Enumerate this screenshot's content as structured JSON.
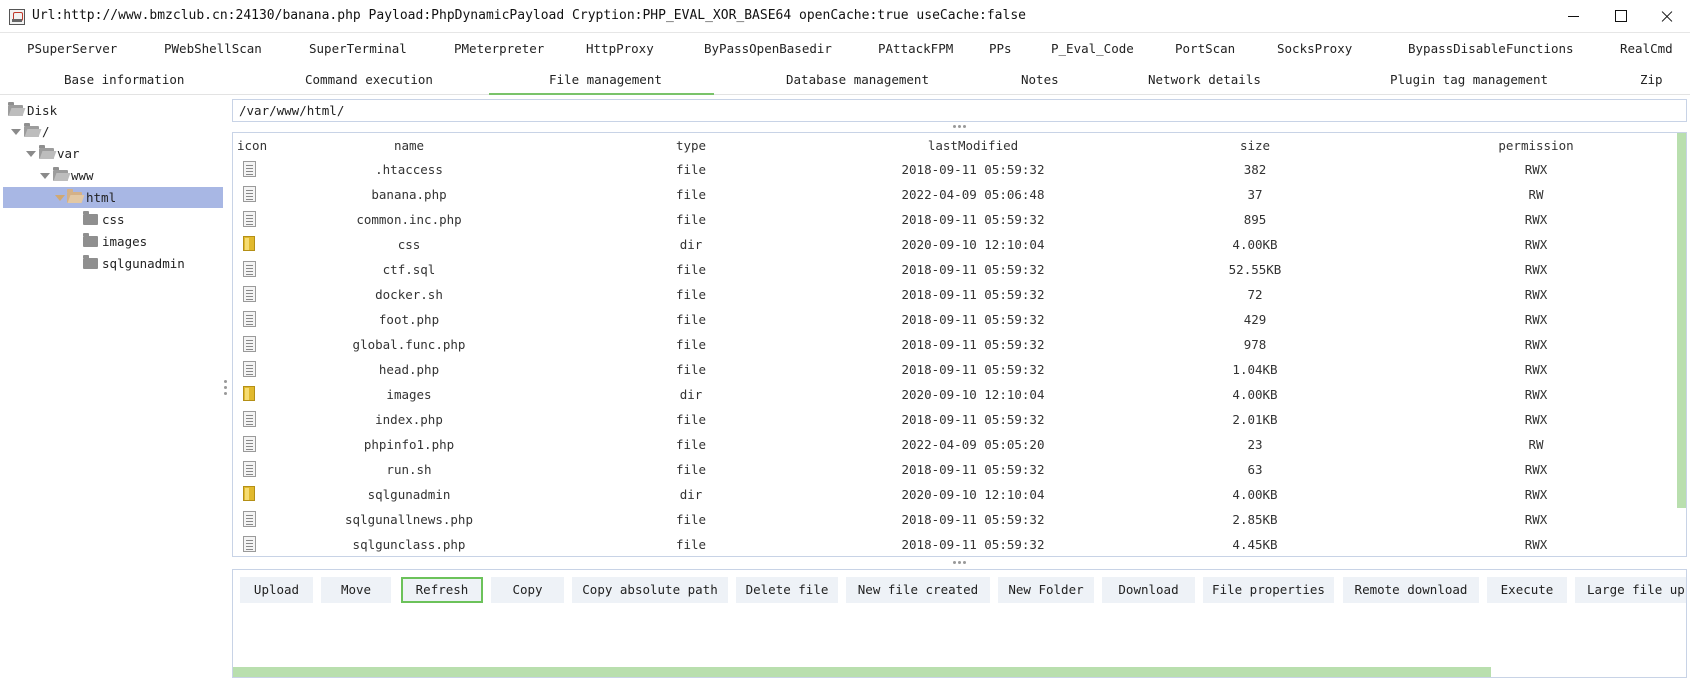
{
  "window": {
    "title": "Url:http://www.bmzclub.cn:24130/banana.php Payload:PhpDynamicPayload Cryption:PHP_EVAL_XOR_BASE64 openCache:true useCache:false"
  },
  "plugin_tabs": [
    "PSuperServer",
    "PWebShellScan",
    "SuperTerminal",
    "PMeterpreter",
    "HttpProxy",
    "ByPassOpenBasedir",
    "PAttackFPM",
    "PPs",
    "P_Eval_Code",
    "PortScan",
    "SocksProxy",
    "BypassDisableFunctions",
    "RealCmd"
  ],
  "main_tabs": [
    "Base information",
    "Command execution",
    "File management",
    "Database management",
    "Notes",
    "Network details",
    "Plugin tag management",
    "Zip"
  ],
  "active_main_tab": "File management",
  "tree": [
    {
      "label": "Disk",
      "icon": "folder-open-icon"
    },
    {
      "label": "/",
      "icon": "folder-open-icon"
    },
    {
      "label": "var",
      "icon": "folder-open-icon"
    },
    {
      "label": "www",
      "icon": "folder-open-icon"
    },
    {
      "label": "html",
      "icon": "folder-open-icon",
      "selected": true
    },
    {
      "label": "css",
      "icon": "folder-icon"
    },
    {
      "label": "images",
      "icon": "folder-icon"
    },
    {
      "label": "sqlgunadmin",
      "icon": "folder-icon"
    }
  ],
  "path": "/var/www/html/",
  "table": {
    "headers": [
      "icon",
      "name",
      "type",
      "lastModified",
      "size",
      "permission"
    ],
    "rows": [
      {
        "name": ".htaccess",
        "type": "file",
        "modified": "2018-09-11 05:59:32",
        "size": "382",
        "perm": "RWX"
      },
      {
        "name": "banana.php",
        "type": "file",
        "modified": "2022-04-09 05:06:48",
        "size": "37",
        "perm": "RW"
      },
      {
        "name": "common.inc.php",
        "type": "file",
        "modified": "2018-09-11 05:59:32",
        "size": "895",
        "perm": "RWX"
      },
      {
        "name": "css",
        "type": "dir",
        "modified": "2020-09-10 12:10:04",
        "size": "4.00KB",
        "perm": "RWX"
      },
      {
        "name": "ctf.sql",
        "type": "file",
        "modified": "2018-09-11 05:59:32",
        "size": "52.55KB",
        "perm": "RWX"
      },
      {
        "name": "docker.sh",
        "type": "file",
        "modified": "2018-09-11 05:59:32",
        "size": "72",
        "perm": "RWX"
      },
      {
        "name": "foot.php",
        "type": "file",
        "modified": "2018-09-11 05:59:32",
        "size": "429",
        "perm": "RWX"
      },
      {
        "name": "global.func.php",
        "type": "file",
        "modified": "2018-09-11 05:59:32",
        "size": "978",
        "perm": "RWX"
      },
      {
        "name": "head.php",
        "type": "file",
        "modified": "2018-09-11 05:59:32",
        "size": "1.04KB",
        "perm": "RWX"
      },
      {
        "name": "images",
        "type": "dir",
        "modified": "2020-09-10 12:10:04",
        "size": "4.00KB",
        "perm": "RWX"
      },
      {
        "name": "index.php",
        "type": "file",
        "modified": "2018-09-11 05:59:32",
        "size": "2.01KB",
        "perm": "RWX"
      },
      {
        "name": "phpinfo1.php",
        "type": "file",
        "modified": "2022-04-09 05:05:20",
        "size": "23",
        "perm": "RW"
      },
      {
        "name": "run.sh",
        "type": "file",
        "modified": "2018-09-11 05:59:32",
        "size": "63",
        "perm": "RWX"
      },
      {
        "name": "sqlgunadmin",
        "type": "dir",
        "modified": "2020-09-10 12:10:04",
        "size": "4.00KB",
        "perm": "RWX"
      },
      {
        "name": "sqlgunallnews.php",
        "type": "file",
        "modified": "2018-09-11 05:59:32",
        "size": "2.85KB",
        "perm": "RWX"
      },
      {
        "name": "sqlgunclass.php",
        "type": "file",
        "modified": "2018-09-11 05:59:32",
        "size": "4.45KB",
        "perm": "RWX"
      }
    ]
  },
  "toolbar": [
    "Upload",
    "Move",
    "Refresh",
    "Copy",
    "Copy absolute path",
    "Delete file",
    "New file created",
    "New Folder",
    "Download",
    "File properties",
    "Remote download",
    "Execute",
    "Large file up"
  ],
  "focused_button": "Refresh",
  "colors": {
    "accent": "#7ac36a",
    "selection": "#a8b7e4",
    "scrollbar": "#b9dfae",
    "button_bg": "#eef2f7"
  }
}
